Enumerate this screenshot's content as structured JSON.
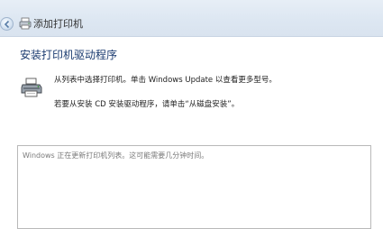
{
  "window": {
    "title": "添加打印机",
    "back_icon": "back-arrow-icon",
    "title_icon": "printer-icon"
  },
  "page": {
    "heading": "安装打印机驱动程序",
    "icon": "printer-icon",
    "description_line1": "从列表中选择打印机。单击 Windows Update 以查看更多型号。",
    "description_line2": "若要从安装 CD 安装驱动程序，请单击“从磁盘安装”。"
  },
  "printer_list": {
    "status_text": "Windows 正在更新打印机列表。这可能需要几分钟时间。"
  },
  "colors": {
    "titlebar": "#dde7f2",
    "heading": "#1b3b70",
    "status_text": "#7a7a7a"
  }
}
